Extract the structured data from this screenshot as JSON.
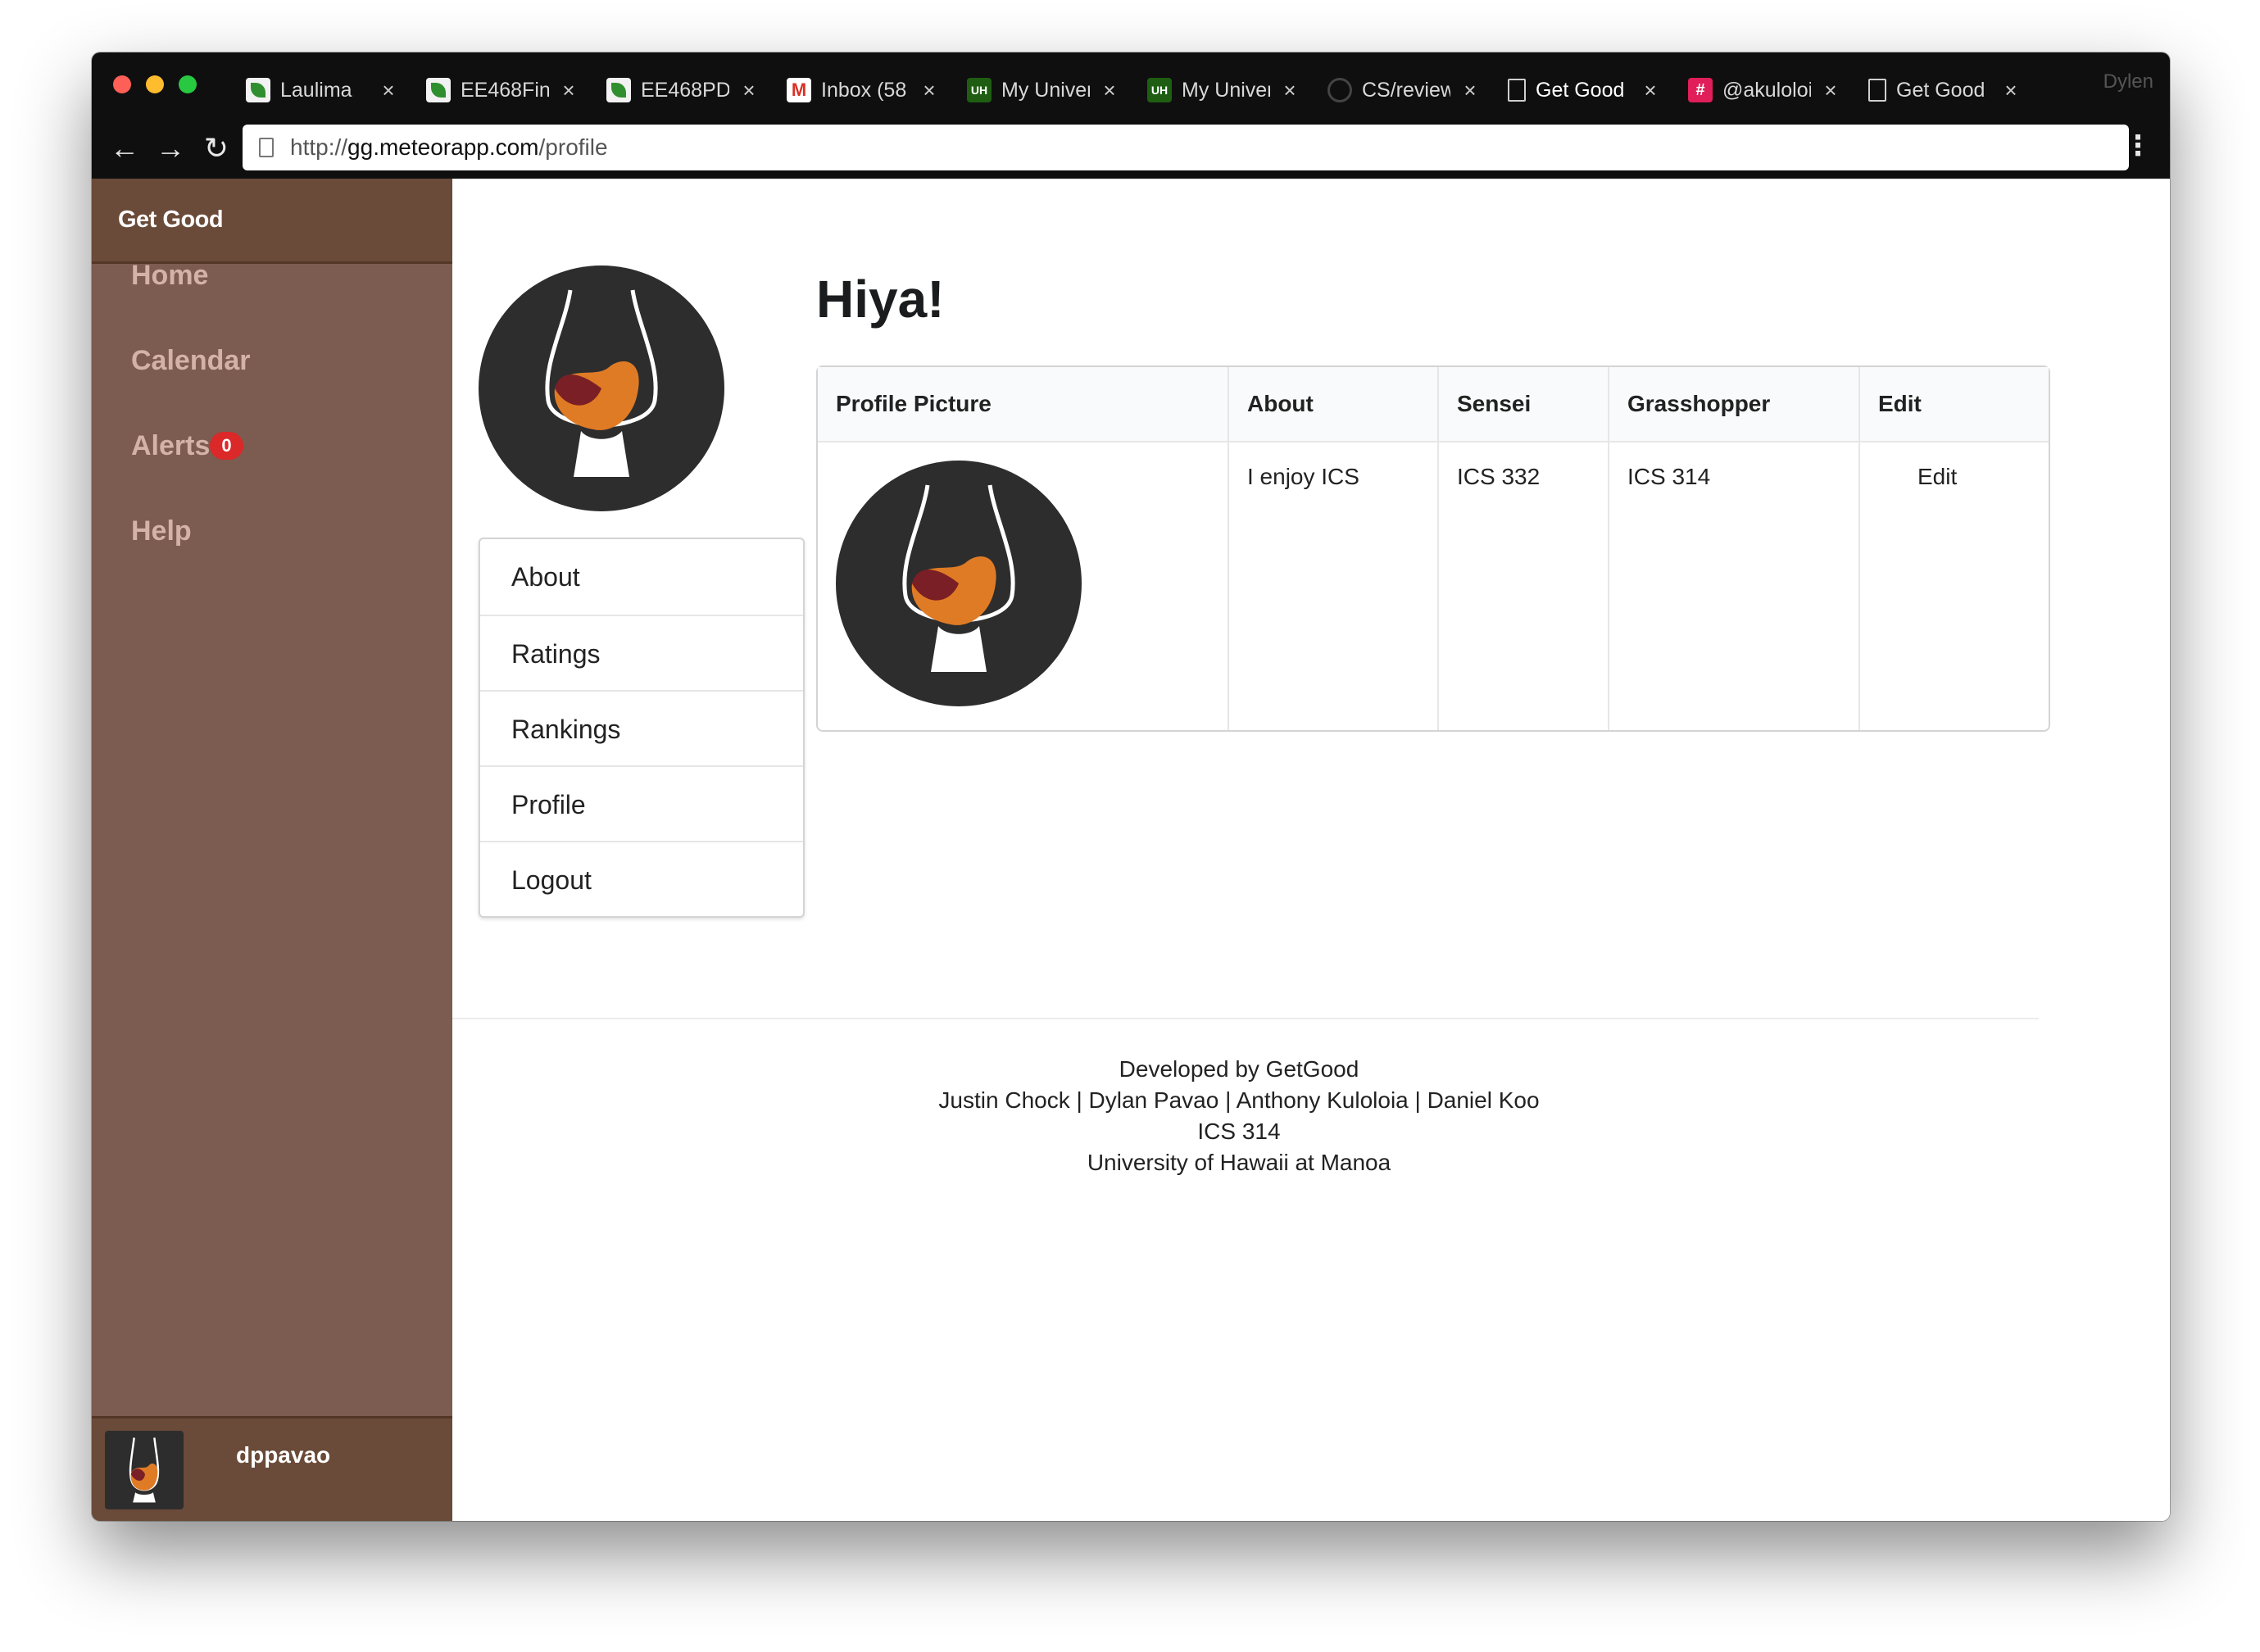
{
  "browser": {
    "tabs": [
      {
        "label": "Laulima",
        "icon": "leaf-favicon-icon"
      },
      {
        "label": "EE468Fin",
        "icon": "leaf-favicon-icon"
      },
      {
        "label": "EE468PD",
        "icon": "leaf-favicon-icon"
      },
      {
        "label": "Inbox (58",
        "icon": "gmail-icon"
      },
      {
        "label": "My Univer",
        "icon": "uh-icon"
      },
      {
        "label": "My Univer",
        "icon": "uh-icon"
      },
      {
        "label": "CS/review",
        "icon": "github-icon"
      },
      {
        "label": "Get Good",
        "icon": "document-icon"
      },
      {
        "label": "@akuloloi",
        "icon": "slack-icon"
      },
      {
        "label": "Get Good",
        "icon": "document-icon"
      }
    ],
    "profile_name": "Dylen",
    "url_scheme": "http://",
    "url_host": "gg.meteorapp.com",
    "url_path": "/profile"
  },
  "sidebar": {
    "brand": "Get Good",
    "items": [
      {
        "label": "Home"
      },
      {
        "label": "Calendar"
      },
      {
        "label": "Alerts",
        "badge": "0"
      },
      {
        "label": "Help"
      }
    ],
    "username": "dppavao"
  },
  "menu": {
    "items": [
      "About",
      "Ratings",
      "Rankings",
      "Profile",
      "Logout"
    ]
  },
  "greeting": "Hiya!",
  "table": {
    "headers": [
      "Profile Picture",
      "About",
      "Sensei",
      "Grasshopper",
      "Edit"
    ],
    "row": {
      "about": "I enjoy ICS",
      "sensei": "ICS 332",
      "grasshopper": "ICS 314",
      "edit": "Edit"
    }
  },
  "footer": {
    "line1": "Developed by GetGood",
    "line2": "Justin Chock | Dylan Pavao | Anthony Kuloloia | Daniel Koo",
    "line3": "ICS 314",
    "line4": "University of Hawaii at Manoa"
  },
  "colors": {
    "sidebar": "#7c5b51",
    "sidebar_header": "#6a4a38",
    "badge": "#db2828"
  }
}
